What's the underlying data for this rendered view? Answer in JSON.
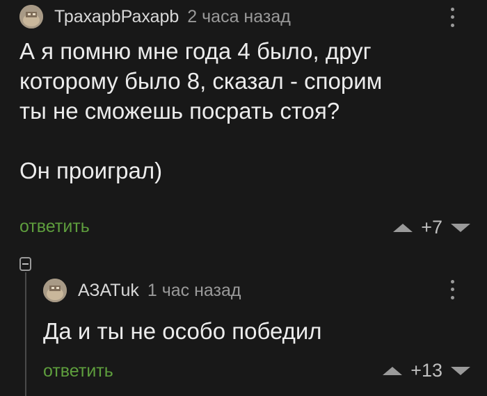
{
  "comments": [
    {
      "author": "ТрахарbРахарb",
      "time": "2 часа назад",
      "text": "А я помню мне года 4 было, друг\nкоторому было 8, сказал - спорим\nты не сможешь посрать стоя?\n\nОн проиграл)",
      "reply_label": "ответить",
      "rating": "+7",
      "avatar_icon": "avatar-icon",
      "menu_icon": "more-vertical-icon"
    },
    {
      "author": "АЗАТuk",
      "time": "1 час назад",
      "text": "Да и ты не особо победил",
      "reply_label": "ответить",
      "rating": "+13",
      "avatar_icon": "avatar-icon",
      "menu_icon": "more-vertical-icon"
    }
  ],
  "colors": {
    "background": "#181818",
    "reply_accent": "#5e9e3d",
    "muted": "#9a9a9a"
  }
}
